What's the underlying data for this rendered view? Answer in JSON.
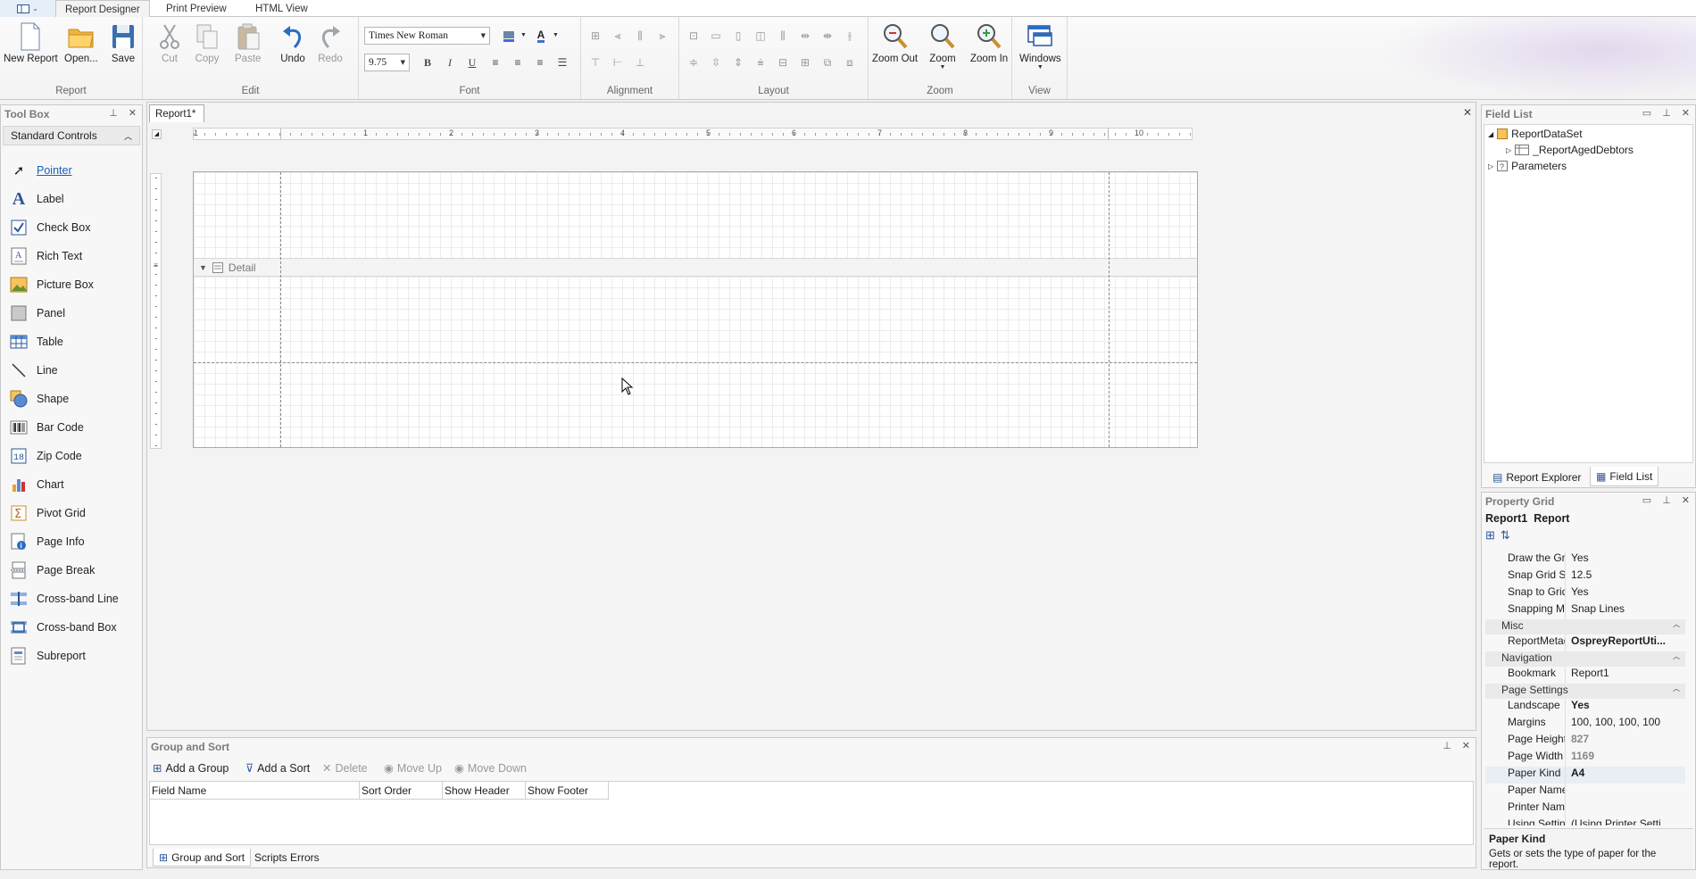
{
  "tabs": [
    "Report Designer",
    "Print Preview",
    "HTML View"
  ],
  "ribbon": {
    "report": {
      "label": "Report",
      "new": "New Report",
      "open": "Open...",
      "save": "Save"
    },
    "edit": {
      "label": "Edit",
      "cut": "Cut",
      "copy": "Copy",
      "paste": "Paste",
      "undo": "Undo",
      "redo": "Redo"
    },
    "font": {
      "label": "Font",
      "family": "Times New Roman",
      "size": "9.75",
      "bold": "B",
      "italic": "I",
      "underline": "U"
    },
    "alignment": {
      "label": "Alignment"
    },
    "layout": {
      "label": "Layout"
    },
    "zoom": {
      "label": "Zoom",
      "out": "Zoom Out",
      "zoom": "Zoom",
      "in": "Zoom In"
    },
    "view": {
      "label": "View",
      "windows": "Windows"
    }
  },
  "toolbox": {
    "title": "Tool Box",
    "section": "Standard Controls",
    "items": [
      "Pointer",
      "Label",
      "Check Box",
      "Rich Text",
      "Picture Box",
      "Panel",
      "Table",
      "Line",
      "Shape",
      "Bar Code",
      "Zip Code",
      "Chart",
      "Pivot Grid",
      "Page Info",
      "Page Break",
      "Cross-band Line",
      "Cross-band Box",
      "Subreport"
    ]
  },
  "document": {
    "tab": "Report1*",
    "detail_band": "Detail",
    "ruler": [
      "1",
      "1",
      "2",
      "3",
      "4",
      "5",
      "6",
      "7",
      "8",
      "9",
      "10"
    ]
  },
  "group_sort": {
    "title": "Group and Sort",
    "add_group": "Add a Group",
    "add_sort": "Add a Sort",
    "delete": "Delete",
    "move_up": "Move Up",
    "move_down": "Move Down",
    "columns": [
      "Field Name",
      "Sort Order",
      "Show Header",
      "Show Footer"
    ],
    "bottom_tabs": [
      "Group and Sort",
      "Scripts Errors"
    ]
  },
  "field_list": {
    "title": "Field List",
    "items": [
      "ReportDataSet",
      "_ReportAgedDebtors",
      "Parameters"
    ],
    "tabs": [
      "Report Explorer",
      "Field List"
    ]
  },
  "property_grid": {
    "title": "Property Grid",
    "object_name": "Report1",
    "object_type": "Report",
    "rows": [
      {
        "k": "Draw the Grid",
        "v": "Yes"
      },
      {
        "k": "Snap Grid Size",
        "v": "12.5"
      },
      {
        "k": "Snap to Grid",
        "v": "Yes"
      },
      {
        "k": "Snapping Mode",
        "v": "Snap Lines"
      }
    ],
    "misc": "Misc",
    "metadata": {
      "k": "ReportMetadat",
      "v": "OspreyReportUti..."
    },
    "navigation": "Navigation",
    "bookmark": {
      "k": "Bookmark",
      "v": "Report1"
    },
    "page_settings": "Page Settings",
    "page_rows": [
      {
        "k": "Landscape",
        "v": "Yes"
      },
      {
        "k": "Margins",
        "v": "100, 100, 100, 100"
      },
      {
        "k": "Page Height",
        "v": "827"
      },
      {
        "k": "Page Width",
        "v": "1169"
      },
      {
        "k": "Paper Kind",
        "v": "A4"
      },
      {
        "k": "Paper Name",
        "v": ""
      },
      {
        "k": "Printer Name",
        "v": ""
      },
      {
        "k": "Using Settings o",
        "v": "(Using Printer Setti..."
      }
    ],
    "desc_title": "Paper Kind",
    "desc_text": "Gets or sets the type of paper for the report."
  }
}
